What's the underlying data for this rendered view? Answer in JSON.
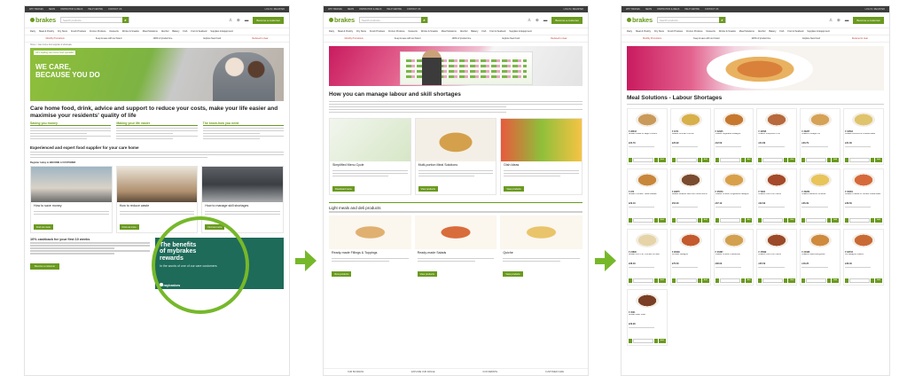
{
  "header": {
    "topstrip": [
      "WHY BRAKES",
      "NEWS",
      "INSPIRATION & IDEAS",
      "HELP CENTRE",
      "CONTACT US"
    ],
    "topstrip_right": "LOG IN / REGISTER",
    "logo": "brakes",
    "search_placeholder": "Search products...",
    "cta": "Become a customer",
    "nav": [
      "Dairy",
      "Meat & Poultry",
      "Dry Store",
      "Fresh Produce",
      "Frozen Produce",
      "Desserts",
      "Drinks & Snacks",
      "Meal Solutions",
      "Alcohol",
      "Bakery",
      "Fish",
      "Fruit & Seafood",
      "Supplies & Equipment"
    ],
    "promos": [
      "Monthly Promotions",
      "Keep & save with our brand",
      "100% of product line",
      "Explore New Food",
      "Reduced to clear"
    ]
  },
  "page1": {
    "breadcrumb": "Home > Care home food supplier & wholesale",
    "hero_tag": "UK's leading care home food specialist",
    "hero_title_1": "WE CARE,",
    "hero_title_2": "BECAUSE YOU DO",
    "heading": "Care home food, drink, advice and support to reduce your costs, make your life easier and maximise your residents' quality of life",
    "col_titles": [
      "Saving you money",
      "Making your life easier",
      "The know-how you need"
    ],
    "subheading": "Experienced and expert food supplier for your care home",
    "register": "Register today to BECOME A CUSTOMER",
    "cards": [
      {
        "title": "How to save money",
        "button": "Find out more"
      },
      {
        "title": "How to reduce waste",
        "button": "Find out more"
      },
      {
        "title": "How to manage skill shortages",
        "button": "Find out more"
      }
    ],
    "promo_title": "10% cashback for your first 10 weeks",
    "promo_button": "Become a customer",
    "benefits_title_1": "The benefits",
    "benefits_title_2": "of mybrakes",
    "benefits_title_3": "rewards",
    "benefits_sub": "In the words of one of our care customers",
    "benefits_logo": "mybrakes"
  },
  "page2": {
    "heading": "How you can manage labour and skill shortages",
    "cards": [
      {
        "title": "Simplified Menu Cycle",
        "button": "Download menu"
      },
      {
        "title": "Multi-portion Meal Solutions",
        "button": "View products"
      },
      {
        "title": "Dish Ideas",
        "button": "View products"
      }
    ],
    "section2": "Light meals and deli products",
    "cards2": [
      {
        "title": "Ready-made Fillings & Toppings",
        "button": "View products"
      },
      {
        "title": "Ready-made Salads",
        "button": "View products"
      },
      {
        "title": "Quiche",
        "button": "View products"
      }
    ],
    "footer": [
      "OUR BUSINESS",
      "EXPLORE OUR RANGE",
      "OUR WEBSITE",
      "CUSTOMER CARE"
    ]
  },
  "page3": {
    "heading": "Meal Solutions - Labour Shortages",
    "add_label": "Add",
    "products": [
      {
        "code": "F 28643",
        "name": "Brakes Roast & Sage Chicken",
        "price": "£34.79"
      },
      {
        "code": "F 1071",
        "name": "Brakes Chicken Korma",
        "price": "£26.99"
      },
      {
        "code": "F 32925",
        "name": "Brakes Vegetable Lasagne",
        "price": "£42.59"
      },
      {
        "code": "F 32595",
        "name": "Brakes Shepherd's Pie",
        "price": "£41.89"
      },
      {
        "code": "F 30287",
        "name": "Brakes Cottage Pie",
        "price": "£33.79"
      },
      {
        "code": "F 32594",
        "name": "Brakes Broccoli & Cheese Bake",
        "price": "£31.39"
      },
      {
        "code": "F 972",
        "name": "Brakes Chicken Tikka Masala",
        "price": "£29.19"
      },
      {
        "code": "F 29875",
        "name": "Brakes Braised Beef with Mushrooms",
        "price": "£52.29"
      },
      {
        "code": "F 35979",
        "name": "Brakes Chicken Vegetable Lasagne",
        "price": "£37.19"
      },
      {
        "code": "F 5903",
        "name": "Brakes Chilli Con Carne",
        "price": "£32.99"
      },
      {
        "code": "F 30280",
        "name": "Brakes Macaroni Cheese",
        "price": "£36.39"
      },
      {
        "code": "F 30281",
        "name": "Brakes Cheese & Tomato Pasta Bake",
        "price": "£36.59"
      },
      {
        "code": "F 24890",
        "name": "Brakes Fish Pie, Chicken & Leek",
        "price": "£38.29"
      },
      {
        "code": "F 28499",
        "name": "All Beef Lasagne",
        "price": "£76.59"
      },
      {
        "code": "F 30387",
        "name": "Brakes Chicken Casserole",
        "price": "£38.09"
      },
      {
        "code": "F 25699",
        "name": "Brakes Chilli Con Carne",
        "price": "£35.59"
      },
      {
        "code": "F 24488",
        "name": "Brakes Pasta Bolognese",
        "price": "£18.26"
      },
      {
        "code": "F 83734",
        "name": "All Lasagne Classic",
        "price": "£39.49"
      },
      {
        "code": "F 4531",
        "name": "Brakes Beef Stew",
        "price": "£29.99"
      }
    ]
  },
  "colors": {
    "brand_green": "#6a9a1f",
    "accent_green": "#76b82a",
    "teal": "#1e6b5a",
    "magenta": "#c91b5f"
  }
}
